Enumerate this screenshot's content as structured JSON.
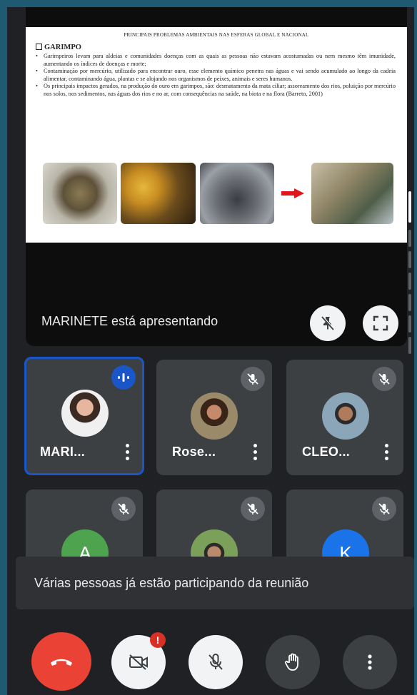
{
  "slide": {
    "title": "PRINCIPAIS PROBLEMAS AMBIENTAIS NAS ESFERAS GLOBAL E NACIONAL",
    "heading": "GARIMPO",
    "bullets": [
      "Garimpeiros levam para aldeias e comunidades doenças com as quais as pessoas não estavam acostumadas ou nem mesmo têm imunidade, aumentando os índices de doenças e morte;",
      "Contaminação por mercúrio, utilizado para encontrar ouro, esse elemento químico penetra nas águas e vai sendo acumulado ao longo da cadeia alimentar, contaminando água, plantas e se alojando nos organismos de peixes, animais e seres humanos.",
      "Os principais impactos gerados, na produção do ouro em garimpos, são: desmatamento da mata ciliar; assoreamento dos rios, poluição por mercúrio nos solos, nos sedimentos, nas águas dos rios e no ar, com consequências na saúde, na biota e na flora (Barreto, 2001)"
    ]
  },
  "presenting_text": "MARINETE está apresentando",
  "participants": [
    {
      "name": "MARI...",
      "state": "speaking",
      "avatar": "photo"
    },
    {
      "name": "Rose...",
      "state": "muted",
      "avatar": "photo"
    },
    {
      "name": "CLEO...",
      "state": "muted",
      "avatar": "photo"
    },
    {
      "name": "",
      "state": "muted",
      "avatar": "letter",
      "letter": "A"
    },
    {
      "name": "",
      "state": "muted",
      "avatar": "photo"
    },
    {
      "name": "",
      "state": "muted",
      "avatar": "letter",
      "letter": "K"
    }
  ],
  "toast": "Várias pessoas já estão participando da reunião",
  "controls": {
    "camera_badge": "!",
    "icons": [
      "end-call-icon",
      "camera-off-icon",
      "mic-off-icon",
      "raise-hand-icon",
      "more-options-icon"
    ]
  },
  "colors": {
    "accent": "#1a56c8",
    "end_call": "#ea4335",
    "tile_bg": "#3c4043",
    "app_bg": "#202124"
  }
}
